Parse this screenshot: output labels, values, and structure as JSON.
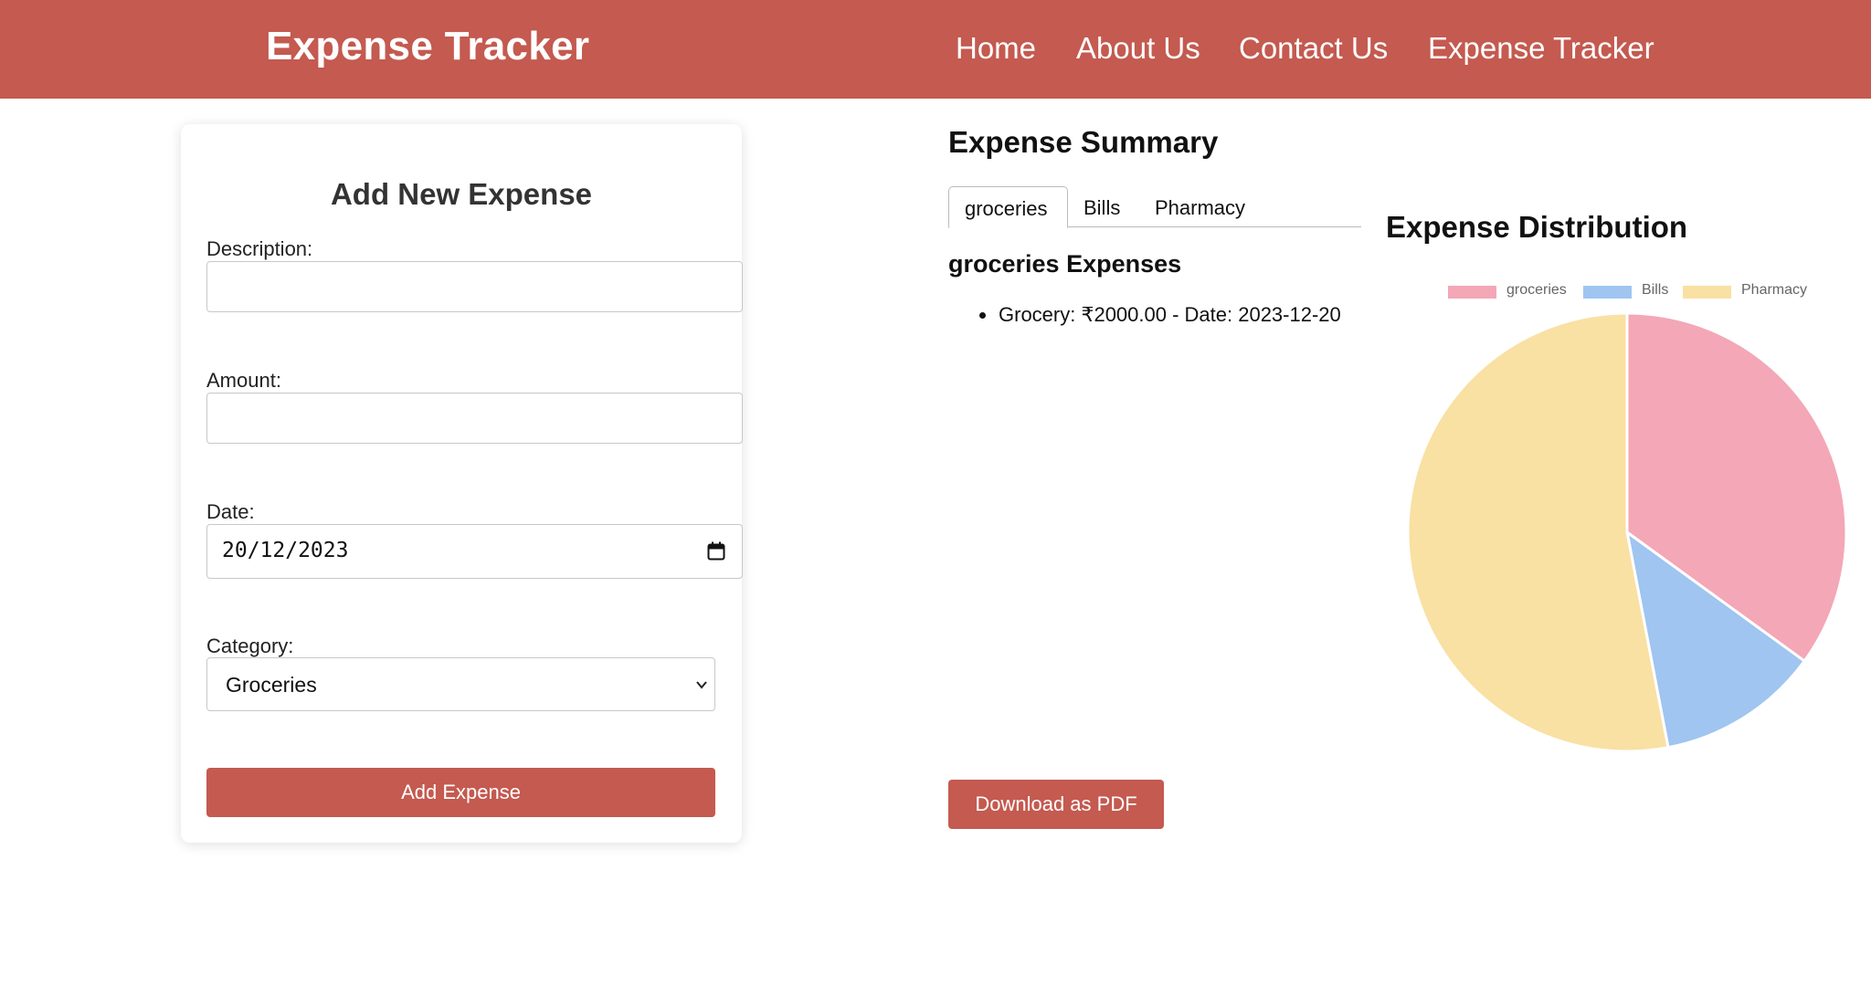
{
  "navbar": {
    "brand": "Expense Tracker",
    "links": [
      "Home",
      "About Us",
      "Contact Us",
      "Expense Tracker"
    ]
  },
  "form": {
    "title": "Add New Expense",
    "description_label": "Description:",
    "description_value": "",
    "amount_label": "Amount:",
    "amount_value": "",
    "date_label": "Date:",
    "date_value": "20/12/2023",
    "category_label": "Category:",
    "category_value": "Groceries",
    "submit_label": "Add Expense"
  },
  "summary": {
    "title": "Expense Summary",
    "tabs": [
      "groceries",
      "Bills",
      "Pharmacy"
    ],
    "active_tab": "groceries",
    "heading": "groceries Expenses",
    "items": [
      "Grocery: ₹2000.00 - Date: 2023-12-20"
    ],
    "download_label": "Download as PDF"
  },
  "distribution": {
    "title": "Expense Distribution"
  },
  "chart_data": {
    "type": "pie",
    "title": "Expense Distribution",
    "legend_position": "top",
    "categories": [
      "groceries",
      "Bills",
      "Pharmacy"
    ],
    "values": [
      35,
      12,
      53
    ],
    "colors": [
      "#f4a7b6",
      "#9fc5f0",
      "#f9e0a3"
    ],
    "border_color": "#ffffff"
  },
  "colors": {
    "brand": "#c45a50",
    "card_shadow": "#d9d9d9"
  }
}
